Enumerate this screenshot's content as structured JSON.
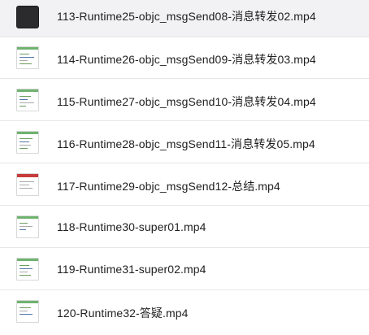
{
  "files": [
    {
      "name": "113-Runtime25-objc_msgSend08-消息转发02.mp4",
      "thumb": "dark-video-thumbnail",
      "selected": true
    },
    {
      "name": "114-Runtime26-objc_msgSend09-消息转发03.mp4",
      "thumb": "code-video-thumbnail",
      "selected": false
    },
    {
      "name": "115-Runtime27-objc_msgSend10-消息转发04.mp4",
      "thumb": "code-video-thumbnail",
      "selected": false
    },
    {
      "name": "116-Runtime28-objc_msgSend11-消息转发05.mp4",
      "thumb": "code-video-thumbnail",
      "selected": false
    },
    {
      "name": "117-Runtime29-objc_msgSend12-总结.mp4",
      "thumb": "red-header-video-thumbnail",
      "selected": false
    },
    {
      "name": "118-Runtime30-super01.mp4",
      "thumb": "code-video-thumbnail",
      "selected": false
    },
    {
      "name": "119-Runtime31-super02.mp4",
      "thumb": "code-video-thumbnail",
      "selected": false
    },
    {
      "name": "120-Runtime32-答疑.mp4",
      "thumb": "code-video-thumbnail",
      "selected": false
    }
  ],
  "colors": {
    "selected_row": "#f2f2f4",
    "separator": "#e6e6e6",
    "text": "#1f1f1f"
  }
}
